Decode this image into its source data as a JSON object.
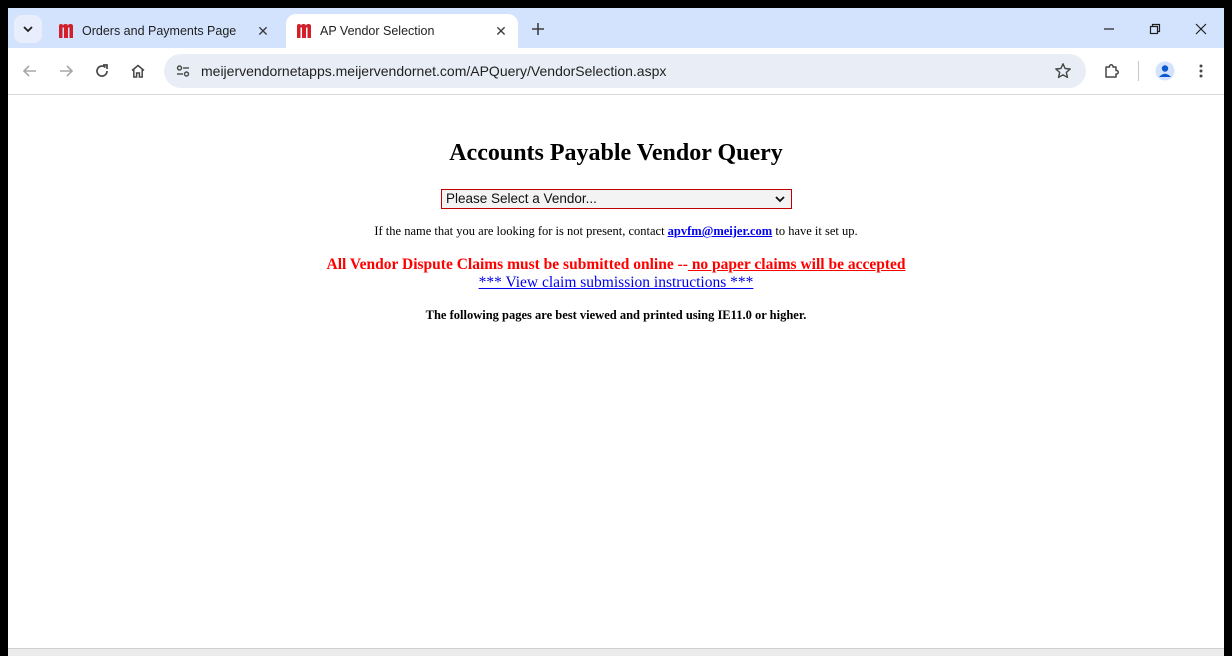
{
  "browser": {
    "tabs": [
      {
        "title": "Orders and Payments Page",
        "favicon": "m-logo-icon",
        "active": false
      },
      {
        "title": "AP Vendor Selection",
        "favicon": "m-logo-icon",
        "active": true
      }
    ],
    "url": "meijervendornetapps.meijervendornet.com/APQuery/VendorSelection.aspx",
    "brand_color": "#d21f2a"
  },
  "page": {
    "heading": "Accounts Payable Vendor Query",
    "vendor_select": {
      "selected": "Please Select a Vendor..."
    },
    "contact": {
      "prefix": "If the name that you are looking for is not present, contact ",
      "email": "apvfm@meijer.com",
      "suffix": " to have it set up."
    },
    "dispute": {
      "lead": "All Vendor Dispute Claims must be submitted online --",
      "emphasis": " no paper claims will be accepted"
    },
    "instructions_link": "*** View claim submission instructions ***",
    "browser_note": "The following pages are best viewed and printed using IE11.0 or higher."
  }
}
